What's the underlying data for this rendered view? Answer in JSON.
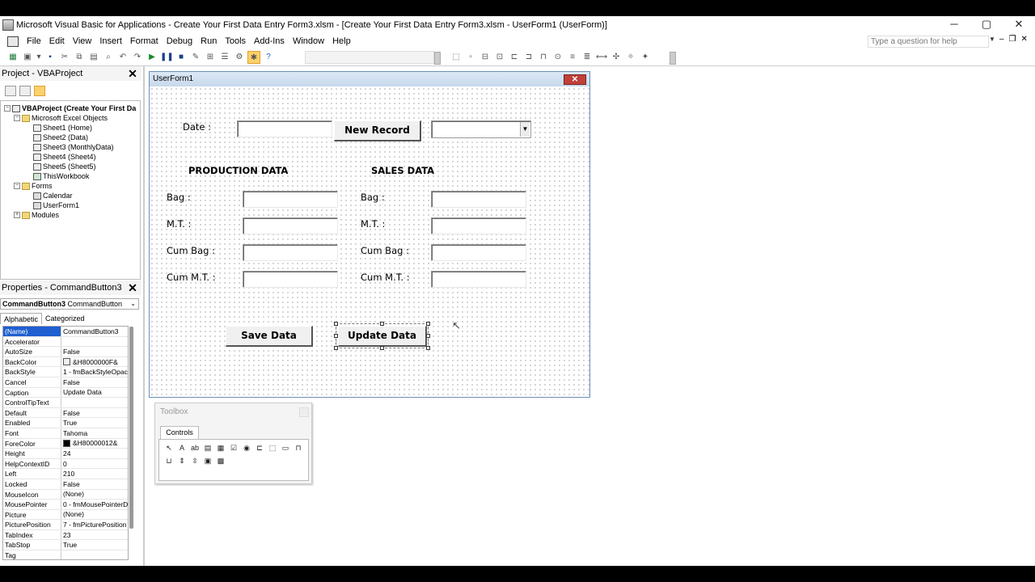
{
  "window": {
    "title": "Microsoft Visual Basic for Applications - Create Your First Data Entry Form3.xlsm - [Create Your First Data Entry Form3.xlsm - UserForm1 (UserForm)]",
    "minimize": "─",
    "maximize": "▢",
    "close": "✕"
  },
  "menu": {
    "items": [
      "File",
      "Edit",
      "View",
      "Insert",
      "Format",
      "Debug",
      "Run",
      "Tools",
      "Add-Ins",
      "Window",
      "Help"
    ],
    "help_placeholder": "Type a question for help"
  },
  "project": {
    "title": "Project - VBAProject",
    "tree": [
      {
        "label": "VBAProject (Create Your First Da",
        "bold": true
      },
      {
        "label": "Microsoft Excel Objects"
      },
      {
        "label": "Sheet1 (Home)"
      },
      {
        "label": "Sheet2 (Data)"
      },
      {
        "label": "Sheet3 (MonthlyData)"
      },
      {
        "label": "Sheet4 (Sheet4)"
      },
      {
        "label": "Sheet5 (Sheet5)"
      },
      {
        "label": "ThisWorkbook"
      },
      {
        "label": "Forms"
      },
      {
        "label": "Calendar"
      },
      {
        "label": "UserForm1"
      },
      {
        "label": "Modules"
      }
    ]
  },
  "properties": {
    "title": "Properties - CommandButton3",
    "object_name": "CommandButton3",
    "object_type": "CommandButton",
    "tab_alphabetic": "Alphabetic",
    "tab_categorized": "Categorized",
    "rows": [
      {
        "name": "(Name)",
        "value": "CommandButton3"
      },
      {
        "name": "Accelerator",
        "value": ""
      },
      {
        "name": "AutoSize",
        "value": "False"
      },
      {
        "name": "BackColor",
        "value": "&H8000000F&"
      },
      {
        "name": "BackStyle",
        "value": "1 - fmBackStyleOpac"
      },
      {
        "name": "Cancel",
        "value": "False"
      },
      {
        "name": "Caption",
        "value": "Update Data"
      },
      {
        "name": "ControlTipText",
        "value": ""
      },
      {
        "name": "Default",
        "value": "False"
      },
      {
        "name": "Enabled",
        "value": "True"
      },
      {
        "name": "Font",
        "value": "Tahoma"
      },
      {
        "name": "ForeColor",
        "value": "&H80000012&"
      },
      {
        "name": "Height",
        "value": "24"
      },
      {
        "name": "HelpContextID",
        "value": "0"
      },
      {
        "name": "Left",
        "value": "210"
      },
      {
        "name": "Locked",
        "value": "False"
      },
      {
        "name": "MouseIcon",
        "value": "(None)"
      },
      {
        "name": "MousePointer",
        "value": "0 - fmMousePointerD"
      },
      {
        "name": "Picture",
        "value": "(None)"
      },
      {
        "name": "PicturePosition",
        "value": "7 - fmPicturePosition"
      },
      {
        "name": "TabIndex",
        "value": "23"
      },
      {
        "name": "TabStop",
        "value": "True"
      },
      {
        "name": "Tag",
        "value": ""
      }
    ]
  },
  "userform": {
    "title": "UserForm1",
    "date_label": "Date :",
    "new_record": "New Record",
    "production_heading": "PRODUCTION DATA",
    "sales_heading": "SALES DATA",
    "bag_label": "Bag :",
    "mt_label": "M.T. :",
    "cum_bag_label": "Cum Bag :",
    "cum_mt_label": "Cum M.T. :",
    "save_data": "Save Data",
    "update_data": "Update Data"
  },
  "toolbox": {
    "title": "Toolbox",
    "tab": "Controls"
  },
  "colors": {
    "selection": "#1f5fd0",
    "form_close": "#c0403a",
    "active_tool": "#fbd26a"
  }
}
